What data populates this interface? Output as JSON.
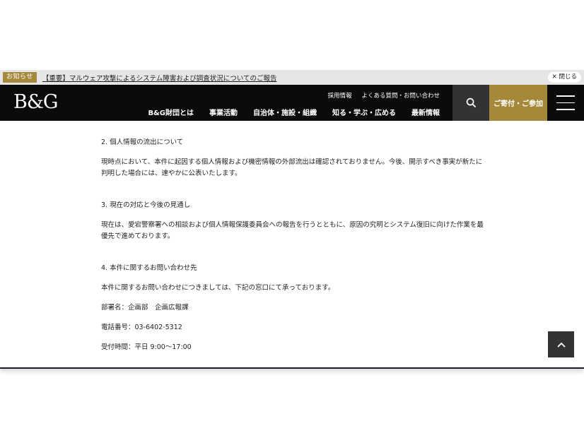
{
  "notice": {
    "badge": "お知らせ",
    "link": "【重要】マルウェア攻撃によるシステム障害および調査状況についてのご報告",
    "close": "✕ 閉じる"
  },
  "header": {
    "logo": "B&G",
    "util_links": [
      "採用情報",
      "よくある質問・お問い合わせ"
    ],
    "nav_links": [
      "B&G財団とは",
      "事業活動",
      "自治体・施設・組織",
      "知る・学ぶ・広める",
      "最新情報"
    ],
    "donate": "ご寄付・ご参加",
    "search_icon": "search-icon",
    "menu_icon": "hamburger-menu-icon"
  },
  "content": {
    "section2_title": "2. 個人情報の流出について",
    "section2_body": "現時点において、本件に起因する個人情報および機密情報の外部流出は確認されておりません。今後、開示すべき事実が新たに判明した場合には、速やかに公表いたします。",
    "section3_title": "3. 現在の対応と今後の見通し",
    "section3_body": "現在は、愛宕警察署への相談および個人情報保護委員会への報告を行うとともに、原因の究明とシステム復旧に向けた作業を最優先で進めております。",
    "section4_title": "4. 本件に関するお問い合わせ先",
    "section4_body": "本件に関するお問い合わせにつきましては、下記の窓口にて承っております。",
    "dept": "部署名：企画部　企画広報課",
    "phone": "電話番号：03-6402-5312",
    "hours": "受付時間：平日 9:00〜17:00"
  },
  "page_top_icon": "chevron-up-icon"
}
